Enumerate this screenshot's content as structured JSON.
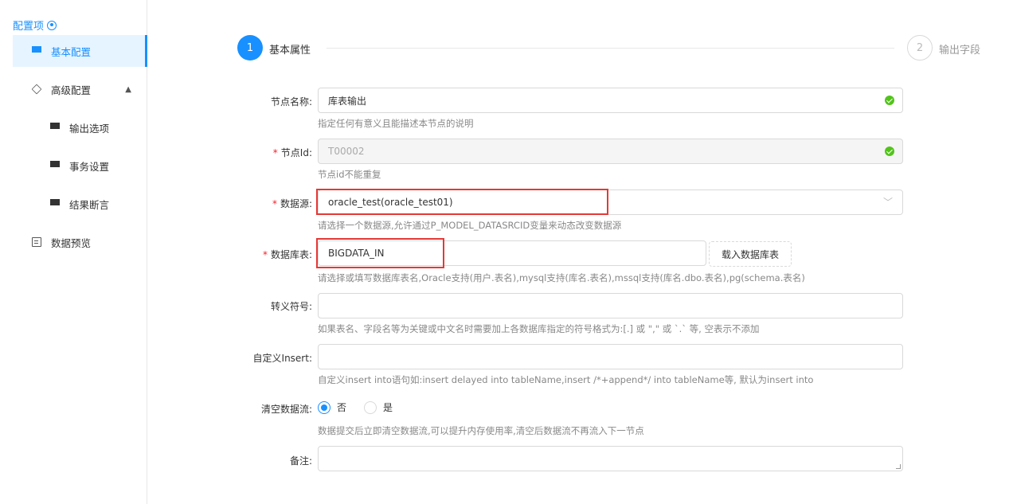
{
  "sidebar": {
    "title": "配置项",
    "items": [
      {
        "label": "基本配置"
      },
      {
        "label": "高级配置"
      },
      {
        "label": "输出选项"
      },
      {
        "label": "事务设置"
      },
      {
        "label": "结果断言"
      },
      {
        "label": "数据预览"
      }
    ]
  },
  "steps": [
    {
      "number": "1",
      "label": "基本属性"
    },
    {
      "number": "2",
      "label": "输出字段"
    }
  ],
  "form": {
    "node_name": {
      "label": "节点名称:",
      "value": "库表输出",
      "help": "指定任何有意义且能描述本节点的说明"
    },
    "node_id": {
      "label": "节点Id:",
      "value": "T00002",
      "help": "节点id不能重复"
    },
    "datasource": {
      "label": "数据源:",
      "value": "oracle_test(oracle_test01)",
      "help": "请选择一个数据源,允许通过P_MODEL_DATASRCID变量来动态改变数据源"
    },
    "db_table": {
      "label": "数据库表:",
      "value": "BIGDATA_IN",
      "button": "载入数据库表",
      "help": "请选择或填写数据库表名,Oracle支持(用户.表名),mysql支持(库名.表名),mssql支持(库名.dbo.表名),pg(schema.表名)"
    },
    "escape_char": {
      "label": "转义符号:",
      "value": "",
      "help": "如果表名、字段名等为关键或中文名时需要加上各数据库指定的符号格式为:[.] 或 \",\" 或 `.` 等, 空表示不添加"
    },
    "custom_insert": {
      "label": "自定义Insert:",
      "value": "",
      "help": "自定义insert into语句如:insert delayed into tableName,insert /*+append*/ into tableName等, 默认为insert into"
    },
    "clear_stream": {
      "label": "清空数据流:",
      "options": [
        "否",
        "是"
      ],
      "selected": "否",
      "help": "数据提交后立即清空数据流,可以提升内存使用率,清空后数据流不再流入下一节点"
    },
    "remark": {
      "label": "备注:",
      "value": ""
    }
  },
  "colors": {
    "accent": "#1890ff",
    "success": "#52c41a",
    "highlight": "#e53935"
  }
}
